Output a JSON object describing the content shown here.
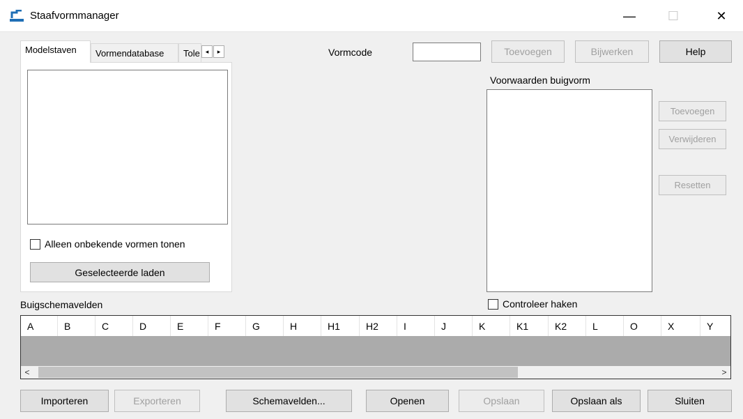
{
  "window": {
    "title": "Staafvormmanager",
    "controls": {
      "minimize": "—",
      "maximize": "☐",
      "close": "✕"
    }
  },
  "tabs": {
    "items": [
      "Modelstaven",
      "Vormendatabase",
      "Tole"
    ],
    "active": "Modelstaven",
    "scroll_left": "◂",
    "scroll_right": "▸"
  },
  "modelstaven": {
    "checkbox_label": "Alleen onbekende vormen tonen",
    "load_button": "Geselecteerde laden"
  },
  "vormcode": {
    "label": "Vormcode",
    "value": "",
    "add_button": "Toevoegen",
    "update_button": "Bijwerken",
    "help_button": "Help"
  },
  "voorwaarden": {
    "label": "Voorwaarden buigvorm",
    "add_button": "Toevoegen",
    "remove_button": "Verwijderen",
    "reset_button": "Resetten",
    "check_hooks_label": "Controleer haken"
  },
  "schema": {
    "label": "Buigschemavelden",
    "columns": [
      "A",
      "B",
      "C",
      "D",
      "E",
      "F",
      "G",
      "H",
      "H1",
      "H2",
      "I",
      "J",
      "K",
      "K1",
      "K2",
      "L",
      "O",
      "X",
      "Y"
    ],
    "scroll_left": "<",
    "scroll_right": ">"
  },
  "footer": {
    "import": "Importeren",
    "export": "Exporteren",
    "schema_fields": "Schemavelden...",
    "open": "Openen",
    "save": "Opslaan",
    "save_as": "Opslaan als",
    "close": "Sluiten"
  }
}
